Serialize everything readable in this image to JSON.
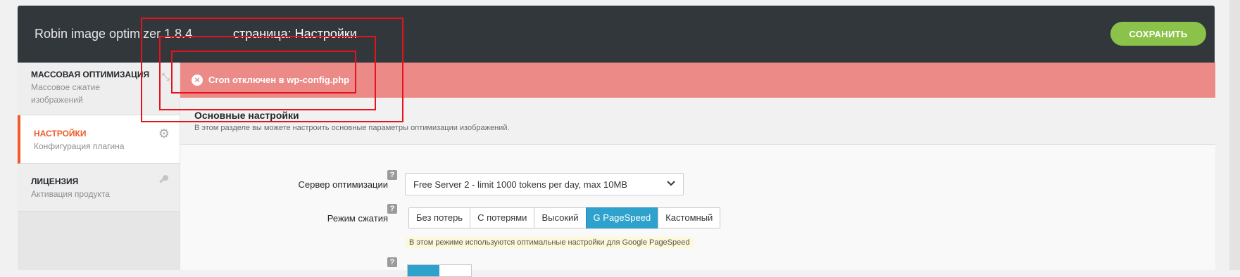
{
  "header": {
    "app_title": "Robin image optimizer 1.8.4",
    "page_title": "страница: Настройки",
    "save_label": "СОХРАНИТЬ"
  },
  "sidebar": {
    "items": [
      {
        "label": "МАССОВАЯ ОПТИМИЗАЦИЯ",
        "sub": "Массовое сжатие изображений",
        "icon": "compress-icon",
        "active": false
      },
      {
        "label": "НАСТРОЙКИ",
        "sub": "Конфигурация плагина",
        "icon": "gear-icon",
        "active": true
      },
      {
        "label": "ЛИЦЕНЗИЯ",
        "sub": "Активация продукта",
        "icon": "key-icon",
        "active": false
      }
    ]
  },
  "alert": {
    "text": "Cron отключен в wp-config.php",
    "icon": "error-circle-icon"
  },
  "section": {
    "title": "Основные настройки",
    "desc": "В этом разделе вы можете настроить основные параметры оптимизации изображений."
  },
  "form": {
    "server_label": "Сервер оптимизации",
    "server_value": "Free Server 2 - limit 1000 tokens per day, max 10MB",
    "mode_label": "Режим сжатия",
    "modes": [
      "Без потерь",
      "С потерями",
      "Высокий",
      "G PageSpeed",
      "Кастомный"
    ],
    "mode_selected": "G PageSpeed",
    "mode_hint": "В этом режиме используются оптимальные настройки для Google PageSpeed",
    "help_symbol": "?"
  },
  "colors": {
    "header_bg": "#32373c",
    "accent_green": "#8bc34a",
    "active_orange": "#f05a28",
    "alert_bg": "#ec8a88",
    "selected_blue": "#2ea2cc",
    "annotation_red": "#e8121b"
  }
}
